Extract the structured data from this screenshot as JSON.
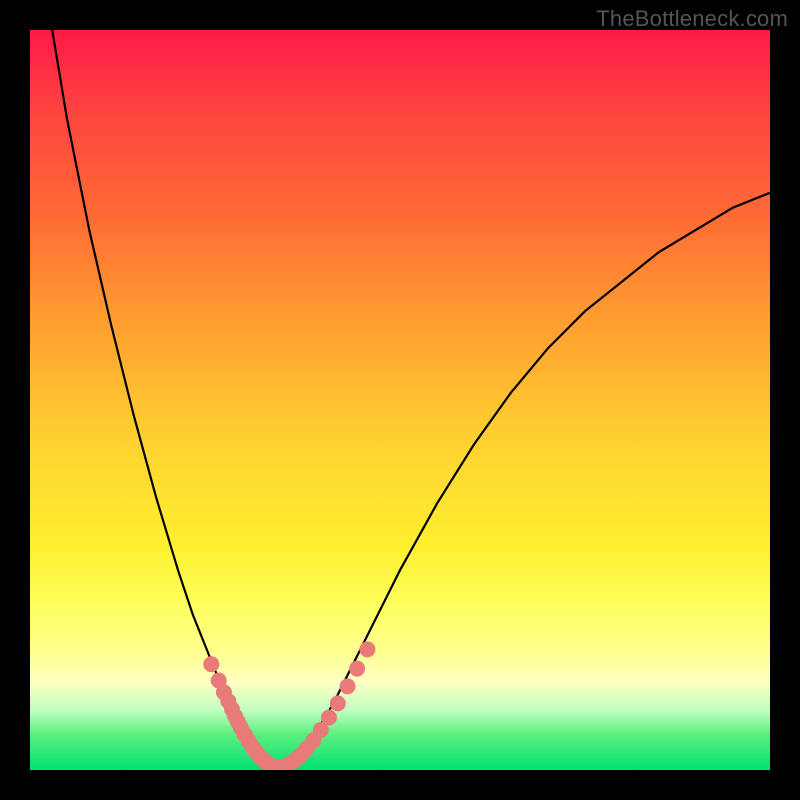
{
  "watermark": "TheBottleneck.com",
  "chart_data": {
    "type": "line",
    "title": "",
    "xlabel": "",
    "ylabel": "",
    "xlim": [
      0,
      100
    ],
    "ylim": [
      0,
      100
    ],
    "series": [
      {
        "name": "curve-left",
        "x": [
          3,
          5,
          8,
          11,
          14,
          17,
          20,
          22,
          24,
          26,
          28,
          29,
          30,
          31,
          32,
          33
        ],
        "y": [
          100,
          88,
          73,
          60,
          48,
          37,
          27,
          21,
          16,
          11,
          7,
          5,
          3.5,
          2,
          1,
          0.3
        ],
        "color": "#000000"
      },
      {
        "name": "curve-right",
        "x": [
          34,
          36,
          38,
          41,
          45,
          50,
          55,
          60,
          65,
          70,
          75,
          80,
          85,
          90,
          95,
          100
        ],
        "y": [
          0.3,
          1.5,
          4,
          9,
          17,
          27,
          36,
          44,
          51,
          57,
          62,
          66,
          70,
          73,
          76,
          78
        ],
        "color": "#000000"
      },
      {
        "name": "markers-left",
        "x": [
          24.5,
          25.5,
          26.2,
          26.8,
          27.3,
          27.7,
          28.1,
          28.5,
          29.0,
          29.5,
          30.0,
          30.5,
          31.0,
          31.5,
          32.0,
          32.5,
          33.0,
          33.5
        ],
        "y": [
          14.3,
          12.1,
          10.5,
          9.3,
          8.2,
          7.3,
          6.5,
          5.7,
          4.8,
          4.0,
          3.2,
          2.5,
          1.9,
          1.4,
          1.0,
          0.6,
          0.4,
          0.25
        ],
        "color": "#e87a7a"
      },
      {
        "name": "markers-right",
        "x": [
          34.0,
          34.6,
          35.2,
          35.9,
          36.6,
          37.4,
          38.3,
          39.3,
          40.4,
          41.6,
          42.9,
          44.2,
          45.6
        ],
        "y": [
          0.3,
          0.55,
          0.9,
          1.4,
          2.0,
          2.9,
          4.0,
          5.4,
          7.1,
          9.0,
          11.3,
          13.7,
          16.3
        ],
        "color": "#e87a7a"
      }
    ]
  }
}
